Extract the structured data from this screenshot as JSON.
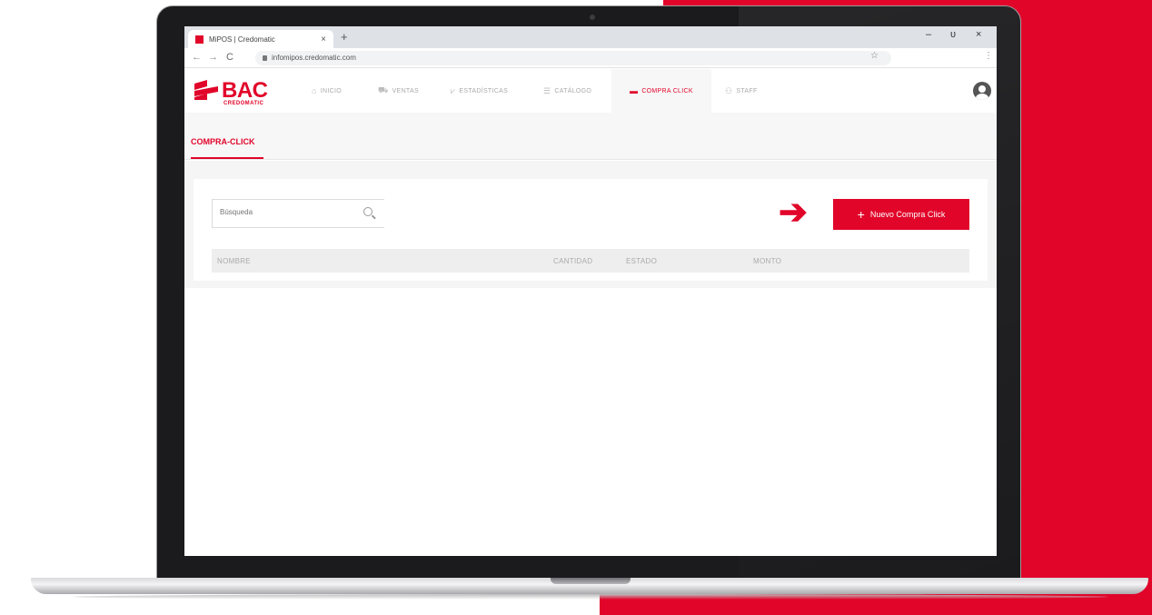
{
  "colors": {
    "brand": "#e1052a",
    "muted_text": "#aaaaaa"
  },
  "browser": {
    "tab_title": "MiPOS | Credomatic",
    "tab_close": "×",
    "new_tab": "+",
    "url": "infomipos.credomatic.com",
    "back": "←",
    "forward": "→",
    "reload": "C",
    "star": "☆",
    "menu": "⋮",
    "minimize": "–",
    "restore": "ᴜ",
    "close": "×"
  },
  "app": {
    "logo_text": "BAC",
    "logo_sub": "CREDOMATIC",
    "nav": [
      {
        "icon": "home-icon",
        "glyph": "⌂",
        "label": "INICIO"
      },
      {
        "icon": "cart-icon",
        "glyph": "⛟",
        "label": "VENTAS"
      },
      {
        "icon": "chart-icon",
        "glyph": "⩗",
        "label": "ESTADÍSTICAS"
      },
      {
        "icon": "list-icon",
        "glyph": "☰",
        "label": "CATÁLOGO"
      },
      {
        "icon": "card-icon",
        "glyph": "▬",
        "label": "COMPRA CLICK",
        "active": true
      },
      {
        "icon": "people-icon",
        "glyph": "⚇",
        "label": "STAFF"
      }
    ],
    "sub_tab": "COMPRA-CLICK"
  },
  "content": {
    "search_placeholder": "Búsqueda",
    "new_button_plus": "+",
    "new_button_label": "Nuevo Compra Click",
    "arrow": "➔",
    "table_headers": [
      "NOMBRE",
      "CANTIDAD",
      "ESTADO",
      "MONTO"
    ]
  }
}
